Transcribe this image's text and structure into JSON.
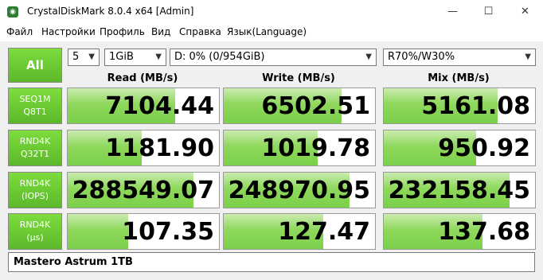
{
  "window": {
    "title": "CrystalDiskMark 8.0.4 x64 [Admin]",
    "minimize": "—",
    "maximize": "☐",
    "close": "✕"
  },
  "menu": [
    "Файл",
    "Настройки",
    "Профиль",
    "Вид",
    "Справка",
    "Язык(Language)"
  ],
  "controls": {
    "all_label": "All",
    "count": "5",
    "size": "1GiB",
    "drive": "D: 0% (0/954GiB)",
    "mix": "R70%/W30%"
  },
  "columns": {
    "read": "Read (MB/s)",
    "write": "Write (MB/s)",
    "mix": "Mix (MB/s)"
  },
  "rows": [
    {
      "label1": "SEQ1M",
      "label2": "Q8T1",
      "read": "7104.44",
      "write": "6502.51",
      "mix": "5161.08",
      "read_fill": 0.71,
      "write_fill": 0.78,
      "mix_fill": 0.75
    },
    {
      "label1": "RND4K",
      "label2": "Q32T1",
      "read": "1181.90",
      "write": "1019.78",
      "mix": "950.92",
      "read_fill": 0.49,
      "write_fill": 0.62,
      "mix_fill": 0.61
    },
    {
      "label1": "RND4K",
      "label2": "(IOPS)",
      "read": "288549.07",
      "write": "248970.95",
      "mix": "232158.45",
      "read_fill": 0.83,
      "write_fill": 0.83,
      "mix_fill": 0.83
    },
    {
      "label1": "RND4K",
      "label2": "(μs)",
      "read": "107.35",
      "write": "127.47",
      "mix": "137.68",
      "read_fill": 0.4,
      "write_fill": 0.66,
      "mix_fill": 0.65
    }
  ],
  "comment": "Mastero Astrum 1TB",
  "colors": {
    "accent_green": "#5cb82a",
    "bar_green": "#8fd85c"
  }
}
